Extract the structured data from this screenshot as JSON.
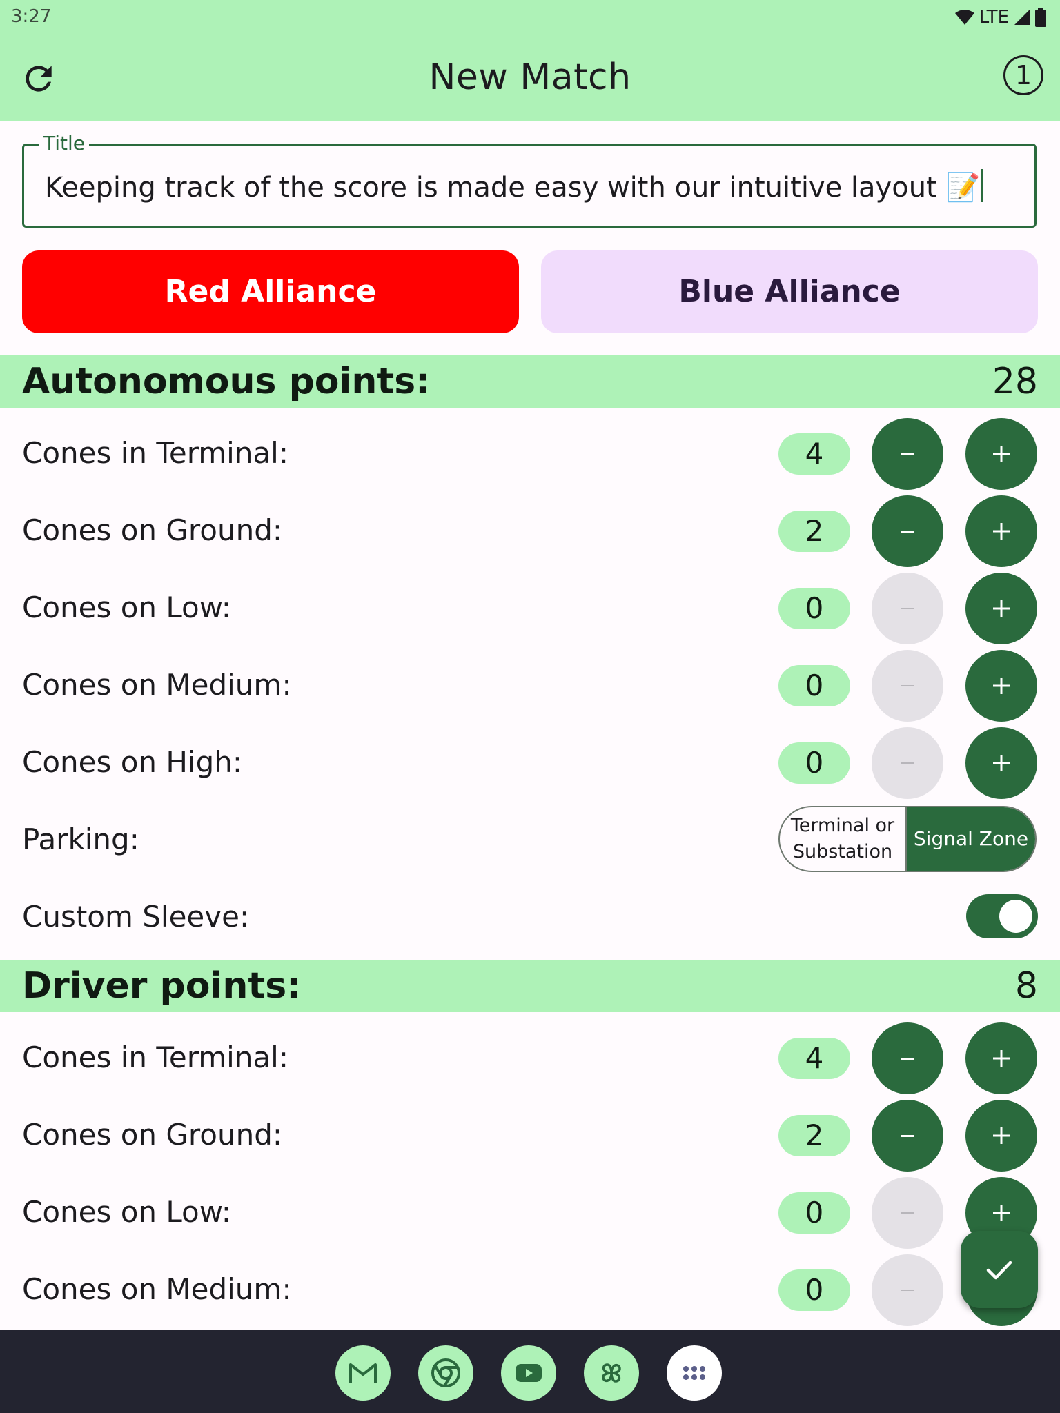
{
  "status_bar": {
    "time": "3:27",
    "network": "LTE",
    "icons": [
      "wifi-icon",
      "signal-icon",
      "battery-icon"
    ]
  },
  "app_bar": {
    "title": "New Match",
    "refresh_icon": "refresh-icon",
    "match_count": "1"
  },
  "title_field": {
    "label": "Title",
    "value": "Keeping track of the score is made easy with our intuitive layout 📝"
  },
  "alliances": {
    "red": "Red Alliance",
    "blue": "Blue Alliance",
    "selected": "red"
  },
  "autonomous": {
    "title": "Autonomous points:",
    "total": "28",
    "rows": [
      {
        "label": "Cones in Terminal:",
        "value": "4",
        "minus_enabled": true
      },
      {
        "label": "Cones on Ground:",
        "value": "2",
        "minus_enabled": true
      },
      {
        "label": "Cones on Low:",
        "value": "0",
        "minus_enabled": false
      },
      {
        "label": "Cones on Medium:",
        "value": "0",
        "minus_enabled": false
      },
      {
        "label": "Cones on High:",
        "value": "0",
        "minus_enabled": false
      }
    ],
    "parking": {
      "label": "Parking:",
      "option_a": "Terminal or Substation",
      "option_b": "Signal Zone",
      "selected": "Signal Zone"
    },
    "custom_sleeve": {
      "label": "Custom Sleeve:",
      "on": true
    }
  },
  "driver": {
    "title": "Driver points:",
    "total": "8",
    "rows": [
      {
        "label": "Cones in Terminal:",
        "value": "4",
        "minus_enabled": true
      },
      {
        "label": "Cones on Ground:",
        "value": "2",
        "minus_enabled": true
      },
      {
        "label": "Cones on Low:",
        "value": "0",
        "minus_enabled": false
      },
      {
        "label": "Cones on Medium:",
        "value": "0",
        "minus_enabled": false
      }
    ]
  },
  "fab": {
    "icon": "check-icon"
  },
  "dock": {
    "apps": [
      "gmail-icon",
      "chrome-icon",
      "youtube-icon",
      "photos-icon",
      "app-drawer-icon"
    ]
  },
  "colors": {
    "accent": "#aef2b7",
    "primary": "#2a6a3d",
    "red_alliance": "#ff0000",
    "blue_alliance": "#f1dcfc"
  }
}
